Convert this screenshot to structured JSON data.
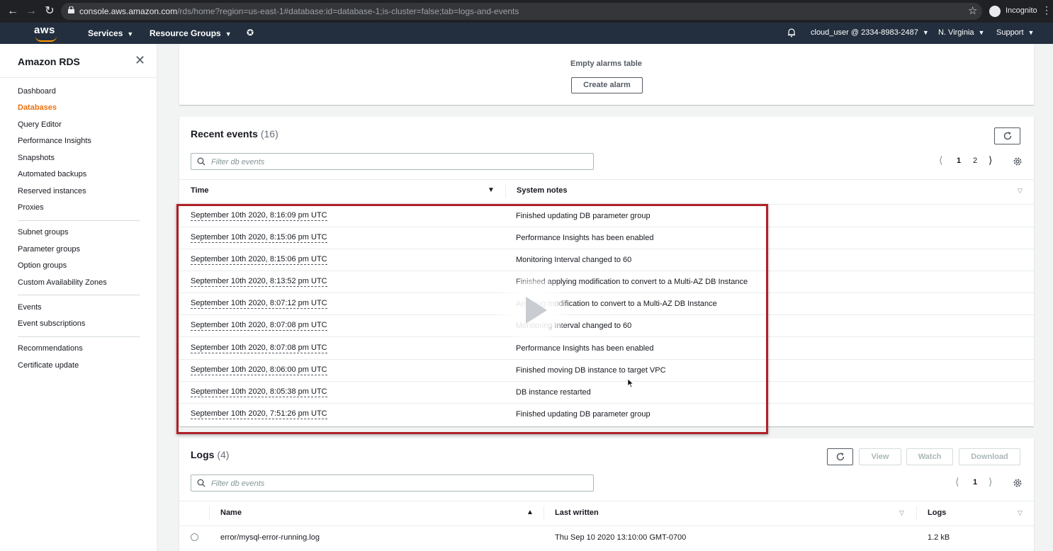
{
  "browser": {
    "url_host": "console.aws.amazon.com",
    "url_path": "/rds/home?region=us-east-1#database:id=database-1;is-cluster=false;tab=logs-and-events",
    "incognito_label": "Incognito"
  },
  "aws_nav": {
    "services": "Services",
    "resource_groups": "Resource Groups",
    "account": "cloud_user @ 2334-8983-2487",
    "region": "N. Virginia",
    "support": "Support"
  },
  "sidebar": {
    "title": "Amazon RDS",
    "groups": [
      [
        "Dashboard",
        "Databases",
        "Query Editor",
        "Performance Insights",
        "Snapshots",
        "Automated backups",
        "Reserved instances",
        "Proxies"
      ],
      [
        "Subnet groups",
        "Parameter groups",
        "Option groups",
        "Custom Availability Zones"
      ],
      [
        "Events",
        "Event subscriptions"
      ],
      [
        "Recommendations",
        "Certificate update"
      ]
    ],
    "active": "Databases"
  },
  "alarms": {
    "empty_text": "Empty alarms table",
    "create_button": "Create alarm"
  },
  "events": {
    "title": "Recent events",
    "count": "(16)",
    "filter_placeholder": "Filter db events",
    "pages": [
      "1",
      "2"
    ],
    "current_page": "1",
    "col_time": "Time",
    "col_notes": "System notes",
    "rows": [
      {
        "time": "September 10th 2020, 8:16:09 pm UTC",
        "note": "Finished updating DB parameter group"
      },
      {
        "time": "September 10th 2020, 8:15:06 pm UTC",
        "note": "Performance Insights has been enabled"
      },
      {
        "time": "September 10th 2020, 8:15:06 pm UTC",
        "note": "Monitoring Interval changed to 60"
      },
      {
        "time": "September 10th 2020, 8:13:52 pm UTC",
        "note": "Finished applying modification to convert to a Multi-AZ DB Instance"
      },
      {
        "time": "September 10th 2020, 8:07:12 pm UTC",
        "note": "Applying modification to convert to a Multi-AZ DB Instance"
      },
      {
        "time": "September 10th 2020, 8:07:08 pm UTC",
        "note": "Monitoring Interval changed to 60"
      },
      {
        "time": "September 10th 2020, 8:07:08 pm UTC",
        "note": "Performance Insights has been enabled"
      },
      {
        "time": "September 10th 2020, 8:06:00 pm UTC",
        "note": "Finished moving DB instance to target VPC"
      },
      {
        "time": "September 10th 2020, 8:05:38 pm UTC",
        "note": "DB instance restarted"
      },
      {
        "time": "September 10th 2020, 7:51:26 pm UTC",
        "note": "Finished updating DB parameter group"
      }
    ]
  },
  "logs": {
    "title": "Logs",
    "count": "(4)",
    "filter_placeholder": "Filter db events",
    "current_page": "1",
    "buttons": {
      "view": "View",
      "watch": "Watch",
      "download": "Download"
    },
    "col_name": "Name",
    "col_last_written": "Last written",
    "col_logs": "Logs",
    "rows": [
      {
        "name": "error/mysql-error-running.log",
        "last_written": "Thu Sep 10 2020 13:10:00 GMT-0700",
        "size": "1.2 kB"
      }
    ]
  },
  "colors": {
    "aws_nav": "#232f3e",
    "aws_orange": "#ff9900",
    "active_link": "#ec7211",
    "highlight_box": "#b0212a"
  }
}
